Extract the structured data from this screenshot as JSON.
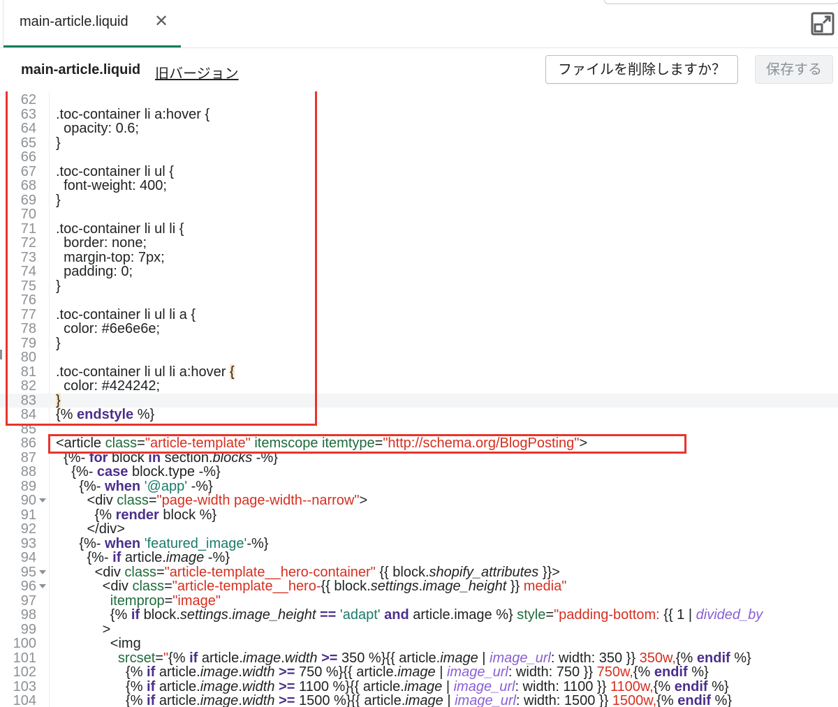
{
  "tab": {
    "label": "main-article.liquid",
    "close_glyph": "✕"
  },
  "header": {
    "title": "main-article.liquid",
    "old_version": "旧バージョン",
    "delete_label": "ファイルを削除しますか？",
    "save_label": "保存する"
  },
  "colors": {
    "accent": "#008060",
    "highlight_box": "#e8342b",
    "keyword": "#4b2f8c",
    "string": "#d62f1f",
    "attribute": "#1f6b3c"
  },
  "editor": {
    "lines": [
      {
        "n": "62",
        "html": ""
      },
      {
        "n": "63",
        "html": ".toc-container li a:hover {"
      },
      {
        "n": "64",
        "html": "  opacity: 0.6;"
      },
      {
        "n": "65",
        "html": "}"
      },
      {
        "n": "66",
        "html": ""
      },
      {
        "n": "67",
        "html": ".toc-container li ul {"
      },
      {
        "n": "68",
        "html": "  font-weight: 400;"
      },
      {
        "n": "69",
        "html": "}"
      },
      {
        "n": "70",
        "html": ""
      },
      {
        "n": "71",
        "html": ".toc-container li ul li {"
      },
      {
        "n": "72",
        "html": "  border: none;"
      },
      {
        "n": "73",
        "html": "  margin-top: 7px;"
      },
      {
        "n": "74",
        "html": "  padding: 0;"
      },
      {
        "n": "75",
        "html": "}"
      },
      {
        "n": "76",
        "html": ""
      },
      {
        "n": "77",
        "html": ".toc-container li ul li a {"
      },
      {
        "n": "78",
        "html": "  color: #6e6e6e;"
      },
      {
        "n": "79",
        "html": "}"
      },
      {
        "n": "80",
        "html": ""
      },
      {
        "n": "81",
        "html": ".toc-container li ul li a:hover <span class=\"br\">{</span>"
      },
      {
        "n": "82",
        "html": "  color: #424242;"
      },
      {
        "n": "83",
        "html": "<span class=\"br\">}</span>",
        "active": true
      },
      {
        "n": "84",
        "html": "{% <span class=\"kw\">endstyle</span> %}"
      },
      {
        "n": "85",
        "html": ""
      },
      {
        "n": "86",
        "html": "&lt;article <span class=\"at\">class</span>=<span class=\"st\">\"article-template\"</span> <span class=\"at\">itemscope itemtype</span>=<span class=\"st\">\"http://schema.org/BlogPosting\"</span>&gt;"
      },
      {
        "n": "87",
        "html": "  {%- <span class=\"kw\">for</span> block <span class=\"kw\">in</span> section.<span class=\"it\">blocks</span> -%}"
      },
      {
        "n": "88",
        "html": "    {%- <span class=\"kw\">case</span> block.type -%}"
      },
      {
        "n": "89",
        "html": "      {%- <span class=\"kw\">when</span> <span class=\"sg\">'@app'</span> -%}"
      },
      {
        "n": "90",
        "html": "        &lt;div <span class=\"at\">class</span>=<span class=\"st\">\"page-width page-width--narrow\"</span>&gt;",
        "fold": true
      },
      {
        "n": "91",
        "html": "          {% <span class=\"kw\">render</span> block %}"
      },
      {
        "n": "92",
        "html": "        &lt;/div&gt;"
      },
      {
        "n": "93",
        "html": "      {%- <span class=\"kw\">when</span> <span class=\"sg\">'featured_image'</span>-%}"
      },
      {
        "n": "94",
        "html": "        {%- <span class=\"kw\">if</span> article.<span class=\"it\">image</span> -%}"
      },
      {
        "n": "95",
        "html": "          &lt;div <span class=\"at\">class</span>=<span class=\"st\">\"article-template__hero-container\"</span> {{ block.<span class=\"it\">shopify_attributes</span> }}&gt;",
        "fold": true
      },
      {
        "n": "96",
        "html": "            &lt;div <span class=\"at\">class</span>=<span class=\"st\">\"article-template__hero-</span>{{ block.<span class=\"it\">settings</span>.<span class=\"it\">image_height</span> }}<span class=\"st\"> media\"</span>",
        "fold": true
      },
      {
        "n": "97",
        "html": "              <span class=\"at\">itemprop</span>=<span class=\"st\">\"image\"</span>"
      },
      {
        "n": "98",
        "html": "              {% <span class=\"kw\">if</span> block.<span class=\"it\">settings</span>.<span class=\"it\">image_height</span> <span class=\"kw\">==</span> <span class=\"sg\">'adapt'</span> <span class=\"kw\">and</span> article.image %} <span class=\"at\">style</span>=<span class=\"st\">\"padding-bottom: </span>{{ 1 | <span class=\"pu\">divided_by</span>"
      },
      {
        "n": "99",
        "html": "            &gt;"
      },
      {
        "n": "100",
        "html": "              &lt;img"
      },
      {
        "n": "101",
        "html": "                <span class=\"at\">srcset</span>=<span class=\"st\">\"</span>{% <span class=\"kw\">if</span> article.<span class=\"it\">image</span>.<span class=\"it\">width</span> <span class=\"kw\">&gt;=</span> 350 %}{{ article.<span class=\"it\">image</span> | <span class=\"pu\">image_url</span>: width: 350 }}<span class=\"st\"> 350w,</span>{% <span class=\"kw\">endif</span> %}"
      },
      {
        "n": "102",
        "html": "                  {% <span class=\"kw\">if</span> article.<span class=\"it\">image</span>.<span class=\"it\">width</span> <span class=\"kw\">&gt;=</span> 750 %}{{ article.<span class=\"it\">image</span> | <span class=\"pu\">image_url</span>: width: 750 }}<span class=\"st\"> 750w,</span>{% <span class=\"kw\">endif</span> %}"
      },
      {
        "n": "103",
        "html": "                  {% <span class=\"kw\">if</span> article.<span class=\"it\">image</span>.<span class=\"it\">width</span> <span class=\"kw\">&gt;=</span> 1100 %}{{ article.<span class=\"it\">image</span> | <span class=\"pu\">image_url</span>: width: 1100 }}<span class=\"st\"> 1100w,</span>{% <span class=\"kw\">endif</span> %}"
      },
      {
        "n": "104",
        "html": "                  {% <span class=\"kw\">if</span> article.<span class=\"it\">image</span>.<span class=\"it\">width</span> <span class=\"kw\">&gt;=</span> 1500 %}{{ article.<span class=\"it\">image</span> | <span class=\"pu\">image_url</span>: width: 1500 }}<span class=\"st\"> 1500w,</span>{% <span class=\"kw\">endif</span> %}"
      }
    ]
  }
}
